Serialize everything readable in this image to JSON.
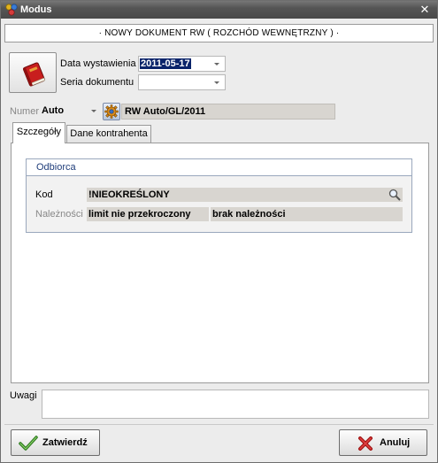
{
  "window": {
    "title": "Modus",
    "app_icon": "modus-logo-icon",
    "close_glyph": "✕"
  },
  "document_header": "· NOWY DOKUMENT RW ( ROZCHÓD WEWNĘTRZNY ) ·",
  "fields": {
    "date_label": "Data wystawienia",
    "date_value": "2011-05-17",
    "series_label": "Seria dokumentu",
    "series_value": "",
    "number_label": "Numer",
    "number_mode": "Auto",
    "number_value": "RW Auto/GL/2011"
  },
  "tabs": [
    {
      "label": "Szczegóły",
      "active": true
    },
    {
      "label": "Dane kontrahenta",
      "active": false
    }
  ],
  "recipient_group": {
    "title": "Odbiorca",
    "kod_label": "Kod",
    "kod_value": "!NIEOKREŚLONY",
    "due_label": "Należności",
    "limit_status": "limit nie przekroczony",
    "due_status": "brak należności"
  },
  "notes": {
    "label": "Uwagi",
    "value": ""
  },
  "buttons": {
    "confirm_label": "Zatwierdź",
    "cancel_label": "Anuluj"
  },
  "icons": {
    "book": "red-book-icon",
    "gear": "gear-icon",
    "search": "magnifier-icon",
    "confirm": "check-icon",
    "cancel": "red-x-icon"
  },
  "colors": {
    "title_bar": "#555555",
    "selection": "#0a246a",
    "group_title": "#1f3d7a",
    "readonly_field": "#d8d5d0"
  }
}
